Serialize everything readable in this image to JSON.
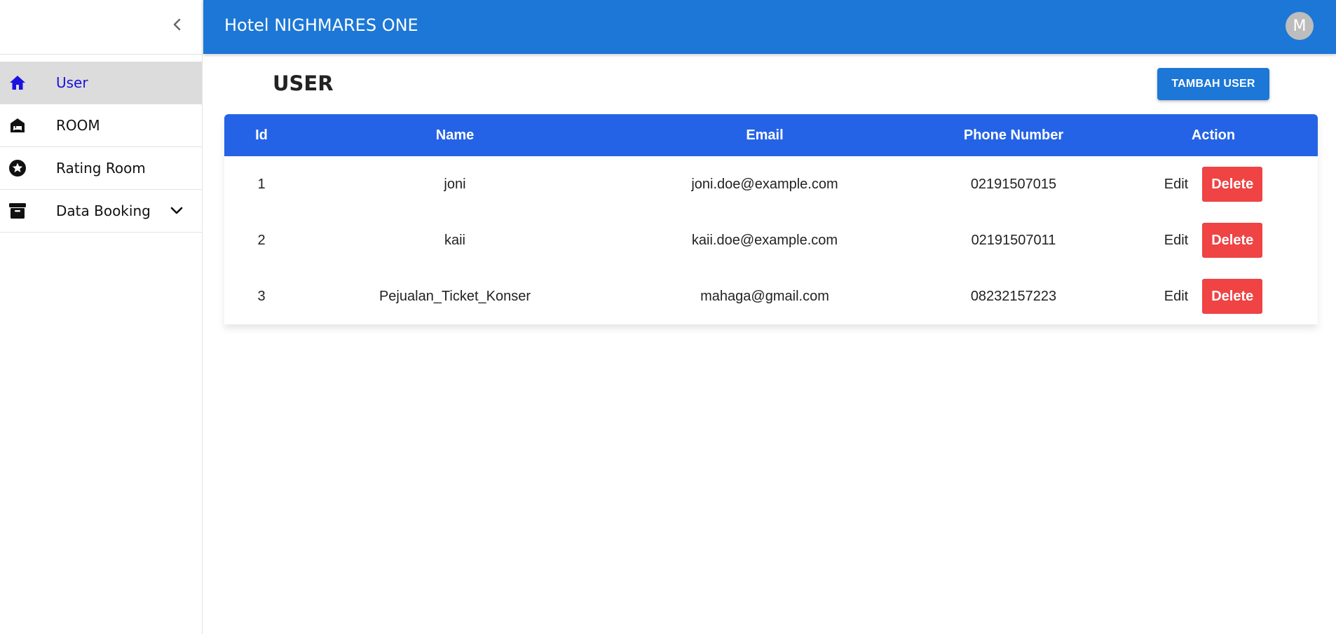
{
  "header": {
    "title": "Hotel NIGHMARES ONE",
    "avatar_initial": "M"
  },
  "sidebar": {
    "items": [
      {
        "label": "User",
        "icon": "home-icon",
        "active": true
      },
      {
        "label": "ROOM",
        "icon": "hotel-bed-icon"
      },
      {
        "label": "Rating Room",
        "icon": "star-circle-icon"
      },
      {
        "label": "Data Booking",
        "icon": "archive-box-icon",
        "has_submenu": true
      }
    ]
  },
  "main": {
    "page_title": "USER",
    "add_button_label": "TAMBAH USER",
    "table": {
      "headers": [
        "Id",
        "Name",
        "Email",
        "Phone Number",
        "Action"
      ],
      "rows": [
        {
          "id": "1",
          "name": "joni",
          "email": "joni.doe@example.com",
          "phone": "02191507015",
          "edit": "Edit",
          "delete": "Delete"
        },
        {
          "id": "2",
          "name": "kaii",
          "email": "kaii.doe@example.com",
          "phone": "02191507011",
          "edit": "Edit",
          "delete": "Delete"
        },
        {
          "id": "3",
          "name": "Pejualan_Ticket_Konser",
          "email": "mahaga@gmail.com",
          "phone": "08232157223",
          "edit": "Edit",
          "delete": "Delete"
        }
      ]
    }
  },
  "colors": {
    "header_bg": "#1c77d6",
    "table_header_bg": "#2563e6",
    "delete_bg": "#ef4344",
    "active_nav_text": "#1a12e0",
    "active_nav_bg": "#dcdcdc"
  }
}
